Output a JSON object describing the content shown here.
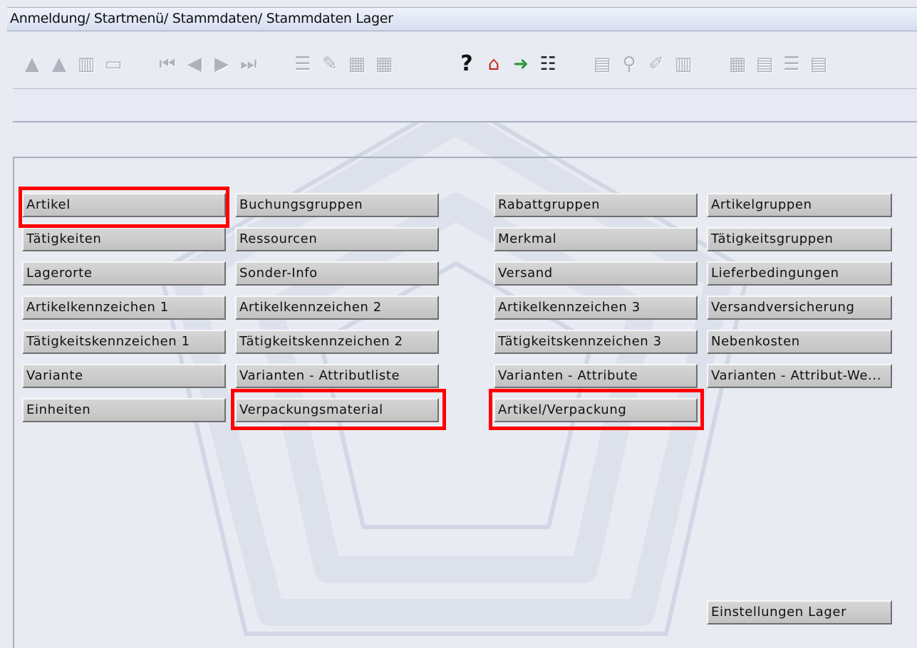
{
  "window": {
    "breadcrumb": "Anmeldung/ Startmenü/ Stammdaten/ Stammdaten Lager"
  },
  "toolbar": {
    "icons": [
      {
        "name": "new-record-icon",
        "glyph": "▲",
        "state": "disabled"
      },
      {
        "name": "copy-record-icon",
        "glyph": "▲",
        "state": "disabled"
      },
      {
        "name": "delete-record-icon",
        "glyph": "▥",
        "state": "disabled"
      },
      {
        "name": "clear-form-icon",
        "glyph": "▭",
        "state": "disabled"
      },
      {
        "name": "first-record-icon",
        "glyph": "⏮",
        "state": "disabled"
      },
      {
        "name": "previous-record-icon",
        "glyph": "◀",
        "state": "disabled"
      },
      {
        "name": "next-record-icon",
        "glyph": "▶",
        "state": "disabled"
      },
      {
        "name": "last-record-icon",
        "glyph": "⏭",
        "state": "disabled"
      },
      {
        "name": "edit-list-icon",
        "glyph": "☰",
        "state": "disabled"
      },
      {
        "name": "edit-note-icon",
        "glyph": "✎",
        "state": "disabled"
      },
      {
        "name": "query-execute-icon",
        "glyph": "▦",
        "state": "disabled"
      },
      {
        "name": "query-enter-icon",
        "glyph": "▦",
        "state": "disabled"
      },
      {
        "name": "help-icon",
        "glyph": "?",
        "state": "active"
      },
      {
        "name": "home-icon",
        "glyph": "⌂",
        "state": "active"
      },
      {
        "name": "exit-icon",
        "glyph": "➜",
        "state": "active"
      },
      {
        "name": "settings-list-icon",
        "glyph": "☷",
        "state": "active"
      },
      {
        "name": "document-icon",
        "glyph": "▤",
        "state": "disabled"
      },
      {
        "name": "search-icon",
        "glyph": "⚲",
        "state": "disabled"
      },
      {
        "name": "edit-pencil-icon",
        "glyph": "✐",
        "state": "disabled"
      },
      {
        "name": "notes-icon",
        "glyph": "▥",
        "state": "disabled"
      },
      {
        "name": "grid-icon",
        "glyph": "▦",
        "state": "disabled"
      },
      {
        "name": "table-edit-icon",
        "glyph": "▤",
        "state": "disabled"
      },
      {
        "name": "list-view-icon",
        "glyph": "☰",
        "state": "disabled"
      },
      {
        "name": "form-view-icon",
        "glyph": "▤",
        "state": "disabled"
      }
    ]
  },
  "buttons": [
    {
      "id": "artikel",
      "label": "Artikel"
    },
    {
      "id": "buchungsgruppen",
      "label": "Buchungsgruppen"
    },
    {
      "id": "rabattgruppen",
      "label": "Rabattgruppen"
    },
    {
      "id": "artikelgruppen",
      "label": "Artikelgruppen"
    },
    {
      "id": "taetigkeiten",
      "label": "Tätigkeiten"
    },
    {
      "id": "ressourcen",
      "label": "Ressourcen"
    },
    {
      "id": "merkmal",
      "label": "Merkmal"
    },
    {
      "id": "taetigkeitsgruppen",
      "label": "Tätigkeitsgruppen"
    },
    {
      "id": "lagerorte",
      "label": "Lagerorte"
    },
    {
      "id": "sonder-info",
      "label": "Sonder-Info"
    },
    {
      "id": "versand",
      "label": "Versand"
    },
    {
      "id": "lieferbedingungen",
      "label": "Lieferbedingungen"
    },
    {
      "id": "artikelkennzeichen-1",
      "label": "Artikelkennzeichen 1"
    },
    {
      "id": "artikelkennzeichen-2",
      "label": "Artikelkennzeichen 2"
    },
    {
      "id": "artikelkennzeichen-3",
      "label": "Artikelkennzeichen 3"
    },
    {
      "id": "versandversicherung",
      "label": "Versandversicherung"
    },
    {
      "id": "taetigkeitskennzeichen-1",
      "label": "Tätigkeitskennzeichen 1"
    },
    {
      "id": "taetigkeitskennzeichen-2",
      "label": "Tätigkeitskennzeichen 2"
    },
    {
      "id": "taetigkeitskennzeichen-3",
      "label": "Tätigkeitskennzeichen 3"
    },
    {
      "id": "nebenkosten",
      "label": "Nebenkosten"
    },
    {
      "id": "variante",
      "label": "Variante"
    },
    {
      "id": "varianten-attributliste",
      "label": "Varianten - Attributliste"
    },
    {
      "id": "varianten-attribute",
      "label": "Varianten - Attribute"
    },
    {
      "id": "varianten-attribut-werte",
      "label": "Varianten - Attribut-We..."
    },
    {
      "id": "einheiten",
      "label": "Einheiten"
    },
    {
      "id": "verpackungsmaterial",
      "label": "Verpackungsmaterial"
    },
    {
      "id": "artikel-verpackung",
      "label": "Artikel/Verpackung"
    },
    {
      "id": "einstellungen-lager",
      "label": "Einstellungen Lager"
    }
  ],
  "highlight_color": "#ff0000"
}
